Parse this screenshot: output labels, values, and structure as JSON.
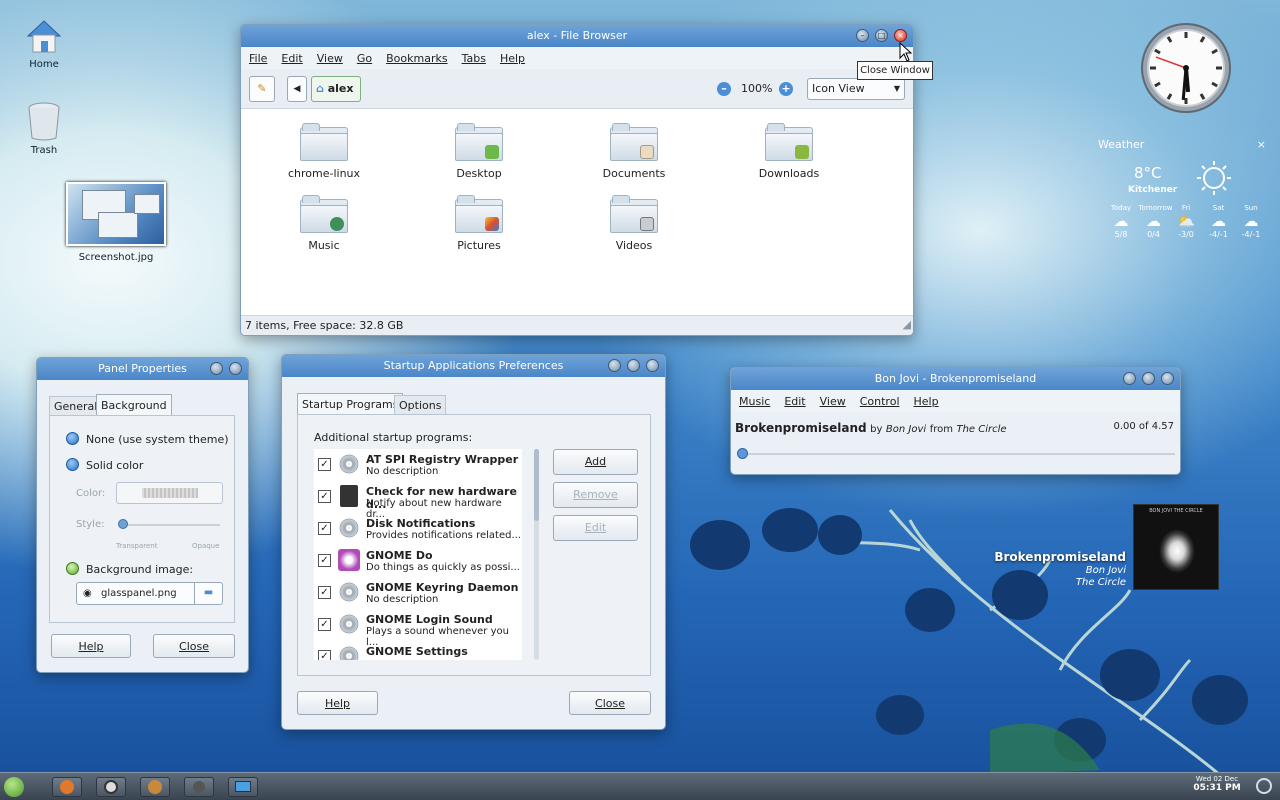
{
  "desktop": {
    "icons": [
      {
        "label": "Home"
      },
      {
        "label": "Trash"
      },
      {
        "label": "Screenshot.jpg"
      }
    ]
  },
  "file_browser": {
    "title": "alex - File Browser",
    "menu": [
      "File",
      "Edit",
      "View",
      "Go",
      "Bookmarks",
      "Tabs",
      "Help"
    ],
    "location": "alex",
    "zoom": "100%",
    "view_mode": "Icon View",
    "tooltip": "Close Window",
    "folders": [
      {
        "name": "chrome-linux",
        "emblem": "none"
      },
      {
        "name": "Desktop",
        "emblem": "green"
      },
      {
        "name": "Documents",
        "emblem": "pen"
      },
      {
        "name": "Downloads",
        "emblem": "download"
      },
      {
        "name": "Music",
        "emblem": "music"
      },
      {
        "name": "Pictures",
        "emblem": "picture"
      },
      {
        "name": "Videos",
        "emblem": "film"
      }
    ],
    "status": "7 items, Free space: 32.8 GB"
  },
  "clock": {
    "label": "analog-clock",
    "hour_angle": 175,
    "minute_angle": 185,
    "second_angle": 290
  },
  "weather": {
    "title": "Weather",
    "temperature": "8°C",
    "city": "Kitchener",
    "forecast": [
      {
        "day": "Today",
        "range": "5/8"
      },
      {
        "day": "Tomorrow",
        "range": "0/4"
      },
      {
        "day": "Fri",
        "range": "-3/0"
      },
      {
        "day": "Sat",
        "range": "-4/-1"
      },
      {
        "day": "Sun",
        "range": "-4/-1"
      }
    ]
  },
  "panel_properties": {
    "title": "Panel Properties",
    "tabs": [
      "General",
      "Background"
    ],
    "options": {
      "none": "None (use system theme)",
      "solid": "Solid color",
      "color_label": "Color:",
      "style_label": "Style:",
      "transparent": "Transparent",
      "opaque": "Opaque",
      "image": "Background image:",
      "image_file": "glasspanel.png"
    },
    "help": "Help",
    "close": "Close"
  },
  "startup": {
    "title": "Startup Applications Preferences",
    "tabs": [
      "Startup Programs",
      "Options"
    ],
    "heading": "Additional startup programs:",
    "programs": [
      {
        "name": "AT SPI Registry Wrapper",
        "desc": "No description"
      },
      {
        "name": "Check for new hardware d...",
        "desc": "Notify about new hardware dr..."
      },
      {
        "name": "Disk Notifications",
        "desc": "Provides notifications related..."
      },
      {
        "name": "GNOME Do",
        "desc": "Do things as quickly as possi..."
      },
      {
        "name": "GNOME Keyring Daemon",
        "desc": "No description"
      },
      {
        "name": "GNOME Login Sound",
        "desc": "Plays a sound whenever you l..."
      },
      {
        "name": "GNOME Settings Daemon",
        "desc": ""
      }
    ],
    "add": "Add",
    "remove": "Remove",
    "edit": "Edit",
    "help": "Help",
    "close": "Close"
  },
  "player": {
    "title": "Bon Jovi - Brokenpromiseland",
    "menu": [
      "Music",
      "Edit",
      "View",
      "Control",
      "Help"
    ],
    "track": "Brokenpromiseland",
    "by": "by",
    "artist": "Bon Jovi",
    "from": "from",
    "album": "The Circle",
    "time": "0.00 of 4.57",
    "progress": 0
  },
  "now_playing": {
    "track": "Brokenpromiseland",
    "artist": "Bon Jovi",
    "album": "The Circle",
    "cover_text": "BON JOVI  THE CIRCLE"
  },
  "taskbar": {
    "date": "Wed 02 Dec",
    "time": "05:31 PM"
  }
}
